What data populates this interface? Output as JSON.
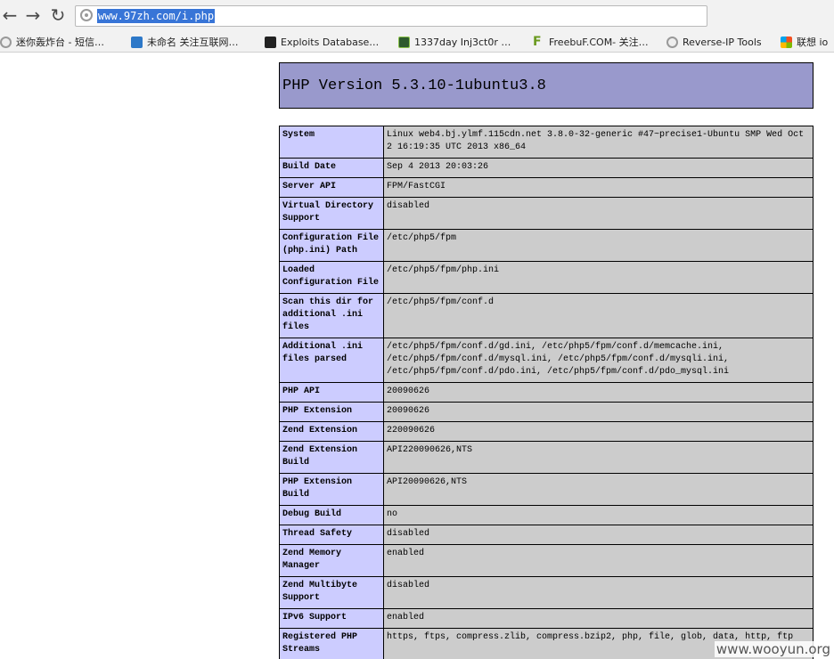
{
  "browser": {
    "url": "www.97zh.com/i.php",
    "bookmarks": [
      {
        "icon": "globe-icon",
        "label": "迷你轰炸台 - 短信…"
      },
      {
        "icon": "mb-icon",
        "label": "未命名 关注互联网…"
      },
      {
        "icon": "exploits-icon",
        "label": "Exploits Database…"
      },
      {
        "icon": "injector-icon",
        "label": "1337day Inj3ct0r …"
      },
      {
        "icon": "freebuf-icon",
        "label": "FreebuF.COM- 关注…"
      },
      {
        "icon": "globe-icon",
        "label": "Reverse-IP Tools"
      },
      {
        "icon": "windows-icon",
        "label": "联想 io"
      }
    ]
  },
  "page": {
    "title": "PHP Version 5.3.10-1ubuntu3.8",
    "rows": [
      {
        "key": "System",
        "value": "Linux web4.bj.ylmf.115cdn.net 3.8.0-32-generic #47~precise1-Ubuntu SMP Wed Oct 2 16:19:35 UTC 2013 x86_64"
      },
      {
        "key": "Build Date",
        "value": "Sep 4 2013 20:03:26"
      },
      {
        "key": "Server API",
        "value": "FPM/FastCGI"
      },
      {
        "key": "Virtual Directory Support",
        "value": "disabled"
      },
      {
        "key": "Configuration File (php.ini) Path",
        "value": "/etc/php5/fpm"
      },
      {
        "key": "Loaded Configuration File",
        "value": "/etc/php5/fpm/php.ini"
      },
      {
        "key": "Scan this dir for additional .ini files",
        "value": "/etc/php5/fpm/conf.d"
      },
      {
        "key": "Additional .ini files parsed",
        "value": "/etc/php5/fpm/conf.d/gd.ini, /etc/php5/fpm/conf.d/memcache.ini, /etc/php5/fpm/conf.d/mysql.ini, /etc/php5/fpm/conf.d/mysqli.ini, /etc/php5/fpm/conf.d/pdo.ini, /etc/php5/fpm/conf.d/pdo_mysql.ini"
      },
      {
        "key": "PHP API",
        "value": "20090626"
      },
      {
        "key": "PHP Extension",
        "value": "20090626"
      },
      {
        "key": "Zend Extension",
        "value": "220090626"
      },
      {
        "key": "Zend Extension Build",
        "value": "API220090626,NTS"
      },
      {
        "key": "PHP Extension Build",
        "value": "API20090626,NTS"
      },
      {
        "key": "Debug Build",
        "value": "no"
      },
      {
        "key": "Thread Safety",
        "value": "disabled"
      },
      {
        "key": "Zend Memory Manager",
        "value": "enabled"
      },
      {
        "key": "Zend Multibyte Support",
        "value": "disabled"
      },
      {
        "key": "IPv6 Support",
        "value": "enabled"
      },
      {
        "key": "Registered PHP Streams",
        "value": "https, ftps, compress.zlib, compress.bzip2, php, file, glob, data, http, ftp"
      }
    ]
  },
  "watermark": "www.wooyun.org",
  "colors": {
    "header_bg": "#9999cc",
    "key_bg": "#ccccff",
    "value_bg": "#cccccc"
  }
}
